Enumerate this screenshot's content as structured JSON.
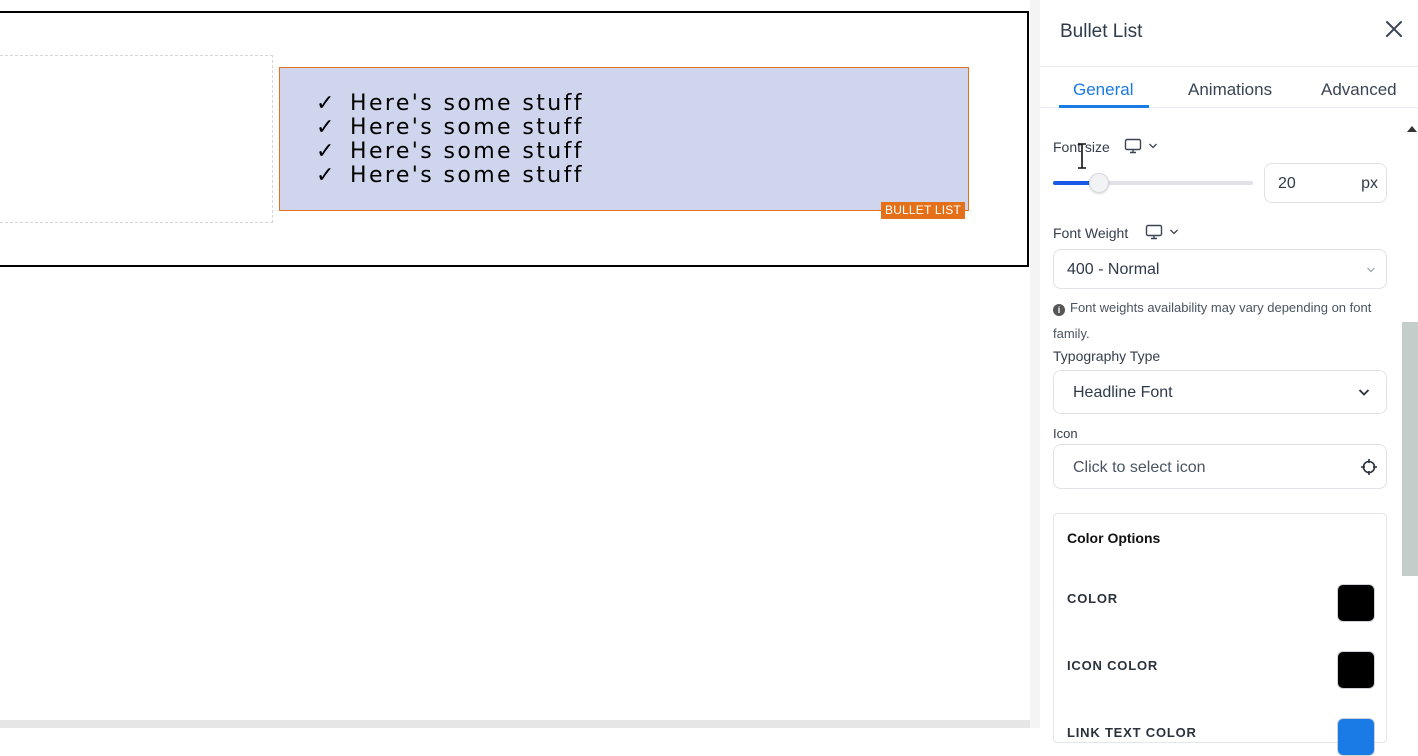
{
  "canvas": {
    "bullet_items": [
      {
        "icon": "✓",
        "text": "Here's some stuff"
      },
      {
        "icon": "✓",
        "text": "Here's some stuff"
      },
      {
        "icon": "✓",
        "text": "Here's some stuff"
      },
      {
        "icon": "✓",
        "text": "Here's some stuff"
      }
    ],
    "element_tag": "BULLET LIST"
  },
  "panel": {
    "title": "Bullet List",
    "tabs": [
      {
        "label": "General",
        "active": true
      },
      {
        "label": "Animations",
        "active": false
      },
      {
        "label": "Advanced",
        "active": false
      }
    ],
    "font_size": {
      "label": "Font size",
      "value": "20",
      "unit": "px",
      "slider_fraction": 0.23
    },
    "font_weight": {
      "label": "Font Weight",
      "selected": "400 - Normal",
      "hint": "Font weights availability may vary depending on font family."
    },
    "typography_type": {
      "label": "Typography Type",
      "selected": "Headline Font"
    },
    "icon_field": {
      "label": "Icon",
      "placeholder": "Click to select icon"
    },
    "color_options": {
      "title": "Color Options",
      "items": [
        {
          "label": "COLOR",
          "value": "#000000"
        },
        {
          "label": "ICON COLOR",
          "value": "#000000"
        },
        {
          "label": "LINK TEXT COLOR",
          "value": "#1a7ae6"
        }
      ]
    }
  },
  "colors": {
    "accent": "#1a7ae6",
    "bullet_background": "#cfd5ec",
    "element_outline": "#e5701a"
  }
}
